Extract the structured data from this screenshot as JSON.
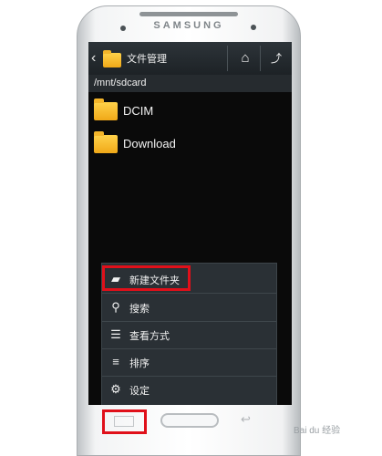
{
  "device": {
    "brand": "SAMSUNG"
  },
  "app": {
    "title": "文件管理",
    "home_icon": "home-icon",
    "up_icon": "folder-up-icon"
  },
  "path": "/mnt/sdcard",
  "folders": [
    {
      "name": "DCIM"
    },
    {
      "name": "Download"
    }
  ],
  "menu": {
    "items": [
      {
        "label": "新建文件夹",
        "icon": "new-folder-icon"
      },
      {
        "label": "搜索",
        "icon": "search-icon"
      },
      {
        "label": "查看方式",
        "icon": "view-mode-icon"
      },
      {
        "label": "排序",
        "icon": "sort-icon"
      },
      {
        "label": "设定",
        "icon": "settings-icon"
      }
    ]
  },
  "highlight_color": "#e0101a",
  "watermark": "Bai du 经验"
}
